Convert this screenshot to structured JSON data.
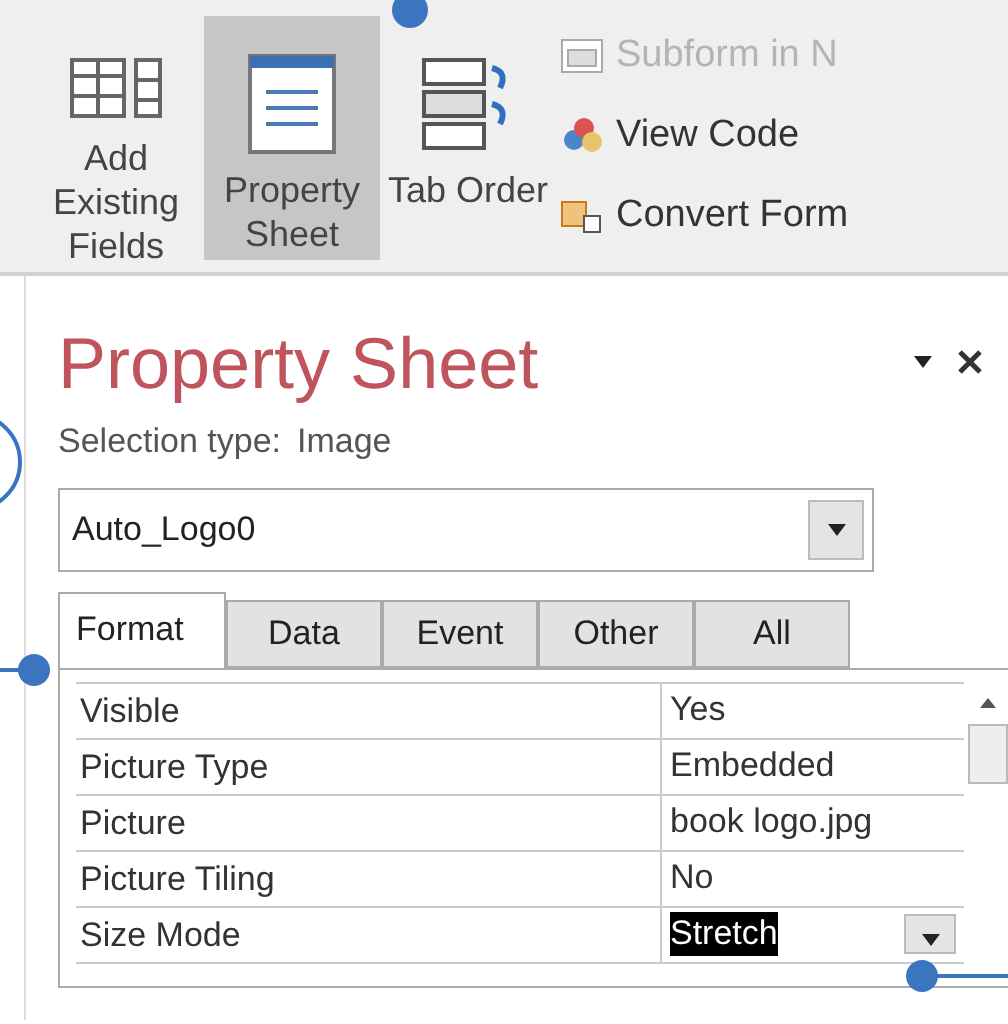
{
  "ribbon": {
    "large_buttons": [
      {
        "label": "Add Existing Fields",
        "selected": false
      },
      {
        "label": "Property Sheet",
        "selected": true
      },
      {
        "label": "Tab Order",
        "selected": false
      }
    ],
    "small_buttons": [
      {
        "label": "Subform in N",
        "disabled": true
      },
      {
        "label": "View Code",
        "disabled": false
      },
      {
        "label": "Convert Form",
        "disabled": false
      }
    ]
  },
  "property_sheet": {
    "title": "Property Sheet",
    "selection_type_label": "Selection type:",
    "selection_type": "Image",
    "object": "Auto_Logo0",
    "tabs": [
      {
        "label": "Format",
        "selected": true
      },
      {
        "label": "Data",
        "selected": false
      },
      {
        "label": "Event",
        "selected": false
      },
      {
        "label": "Other",
        "selected": false
      },
      {
        "label": "All",
        "selected": false
      }
    ],
    "properties": [
      {
        "name": "Visible",
        "value": "Yes",
        "selected": false
      },
      {
        "name": "Picture Type",
        "value": "Embedded",
        "selected": false
      },
      {
        "name": "Picture",
        "value": "book logo.jpg",
        "selected": false
      },
      {
        "name": "Picture Tiling",
        "value": "No",
        "selected": false
      },
      {
        "name": "Size Mode",
        "value": "Stretch",
        "selected": true
      }
    ]
  }
}
